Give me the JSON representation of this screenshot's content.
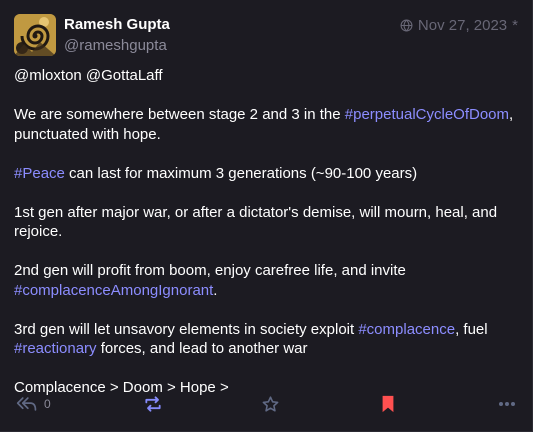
{
  "post": {
    "author": {
      "display_name": "Ramesh Gupta",
      "handle": "@rameshgupta",
      "avatar": "ornate-gold-spiral-avatar"
    },
    "meta": {
      "visibility_icon": "globe-icon",
      "timestamp": "Nov 27, 2023",
      "edited_marker": "*"
    },
    "content": {
      "mentions_line": "@mloxton @GottaLaff",
      "p1_before": "We are somewhere between stage 2 and 3 in the ",
      "p1_tag": "#perpetualCycleOfDoom",
      "p1_after": ", punctuated with hope.",
      "p2_tag": "#Peace",
      "p2_after": " can last for maximum 3 generations (~90-100 years)",
      "p3": "1st gen after major war, or after a dictator's demise, will mourn, heal, and rejoice.",
      "p4_before": "2nd gen will profit from boom, enjoy carefree life, and invite ",
      "p4_tag": "#complacenceAmongIgnorant",
      "p4_after": ".",
      "p5_before": "3rd gen will let unsavory elements in society exploit ",
      "p5_tag1": "#complacence",
      "p5_mid": ", fuel ",
      "p5_tag2": "#reactionary",
      "p5_after": " forces, and lead to another war",
      "p6": "Complacence > Doom > Hope >"
    },
    "actions": {
      "reply_icon": "reply-all-icon",
      "reply_count": "0",
      "boost_icon": "boost-icon",
      "favourite_icon": "star-icon",
      "bookmark_icon": "bookmark-icon",
      "more_icon": "more-dots-icon"
    },
    "colors": {
      "background": "#1c1b22",
      "link": "#8c8dff",
      "muted": "#8b8a99",
      "boost_active": "#858afa",
      "bookmark_active": "#ff5050",
      "icon": "#606984"
    }
  }
}
